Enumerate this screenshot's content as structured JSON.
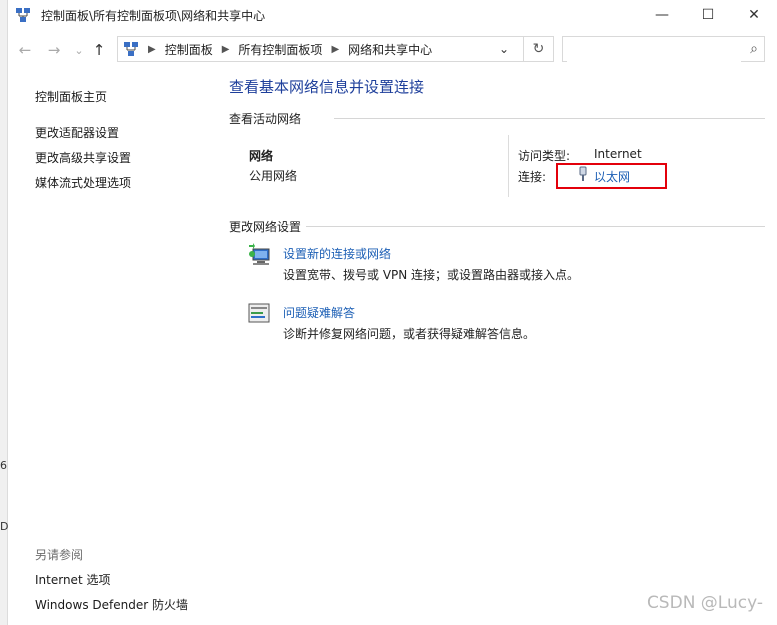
{
  "window": {
    "title": "控制面板\\所有控制面板项\\网络和共享中心",
    "controls": {
      "minimize": "—",
      "maximize": "☐",
      "close": "✕"
    }
  },
  "nav": {
    "back": "←",
    "forward": "→",
    "recent": "⌄",
    "up": "↑",
    "breadcrumbs": [
      "控制面板",
      "所有控制面板项",
      "网络和共享中心"
    ],
    "dropdown": "⌄",
    "refresh": "↻",
    "search_placeholder": "",
    "search_icon": "⌕"
  },
  "left_strip_marks": [
    "6",
    "D"
  ],
  "sidebar": {
    "home": "控制面板主页",
    "items": [
      "更改适配器设置",
      "更改高级共享设置",
      "媒体流式处理选项"
    ],
    "see_also_title": "另请参阅",
    "see_also": [
      "Internet 选项",
      "Windows Defender 防火墙"
    ]
  },
  "main": {
    "heading": "查看基本网络信息并设置连接",
    "active_title": "查看活动网络",
    "network_name": "网络",
    "network_type": "公用网络",
    "access_type_label": "访问类型:",
    "access_type_value": "Internet",
    "connection_label": "连接:",
    "connection_value": "以太网",
    "change_title": "更改网络设置",
    "tasks": [
      {
        "link": "设置新的连接或网络",
        "desc": "设置宽带、拨号或 VPN 连接；或设置路由器或接入点。",
        "icon": "network-setup-icon"
      },
      {
        "link": "问题疑难解答",
        "desc": "诊断并修复网络问题，或者获得疑难解答信息。",
        "icon": "troubleshoot-icon"
      }
    ]
  },
  "watermark": "CSDN @Lucy-",
  "colors": {
    "heading": "#1e3f9b",
    "link": "#1c5fb5",
    "highlight_box": "#e3000b"
  }
}
